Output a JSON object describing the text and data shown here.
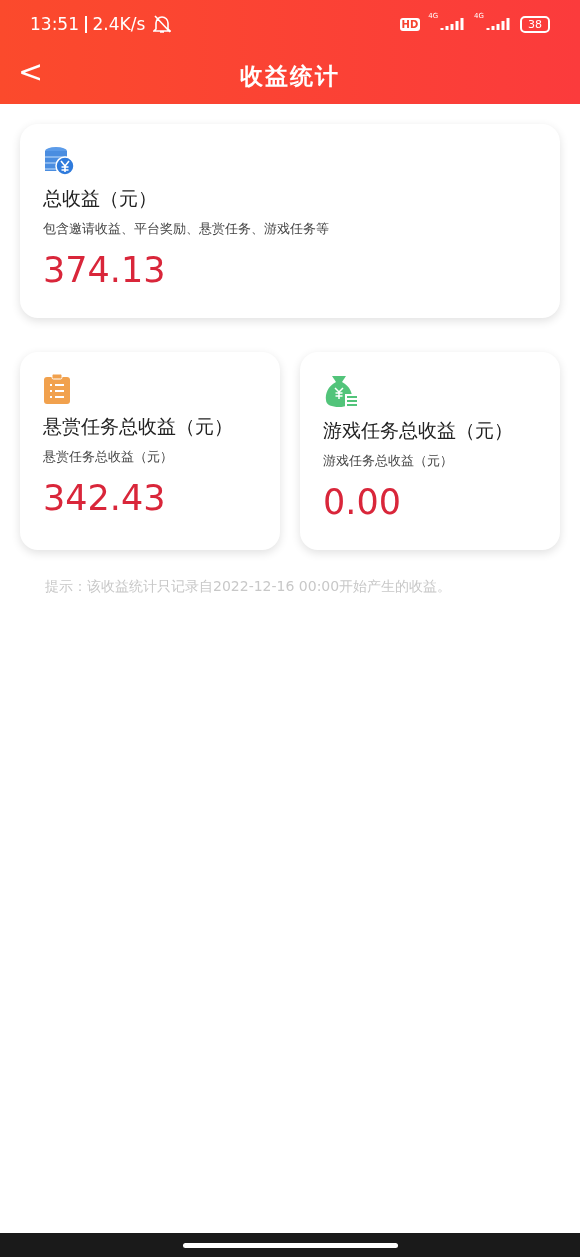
{
  "status_bar": {
    "time": "13:51",
    "speed": "2.4K/s",
    "hd": "HD",
    "network_1": "4G",
    "network_2": "4G",
    "battery": "38"
  },
  "header": {
    "back": "<",
    "title": "收益统计"
  },
  "cards": [
    {
      "kind": "coins",
      "title": "总收益（元）",
      "subtitle": "包含邀请收益、平台奖励、悬赏任务、游戏任务等",
      "amount": "374.13"
    },
    {
      "kind": "clipboard",
      "title": "悬赏任务总收益（元）",
      "subtitle": "悬赏任务总收益（元）",
      "amount": "342.43"
    },
    {
      "kind": "moneybag",
      "title": "游戏任务总收益（元）",
      "subtitle": "游戏任务总收益（元）",
      "amount": "0.00"
    }
  ],
  "hint": "提示：该收益统计只记录自2022-12-16 00:00开始产生的收益。"
}
